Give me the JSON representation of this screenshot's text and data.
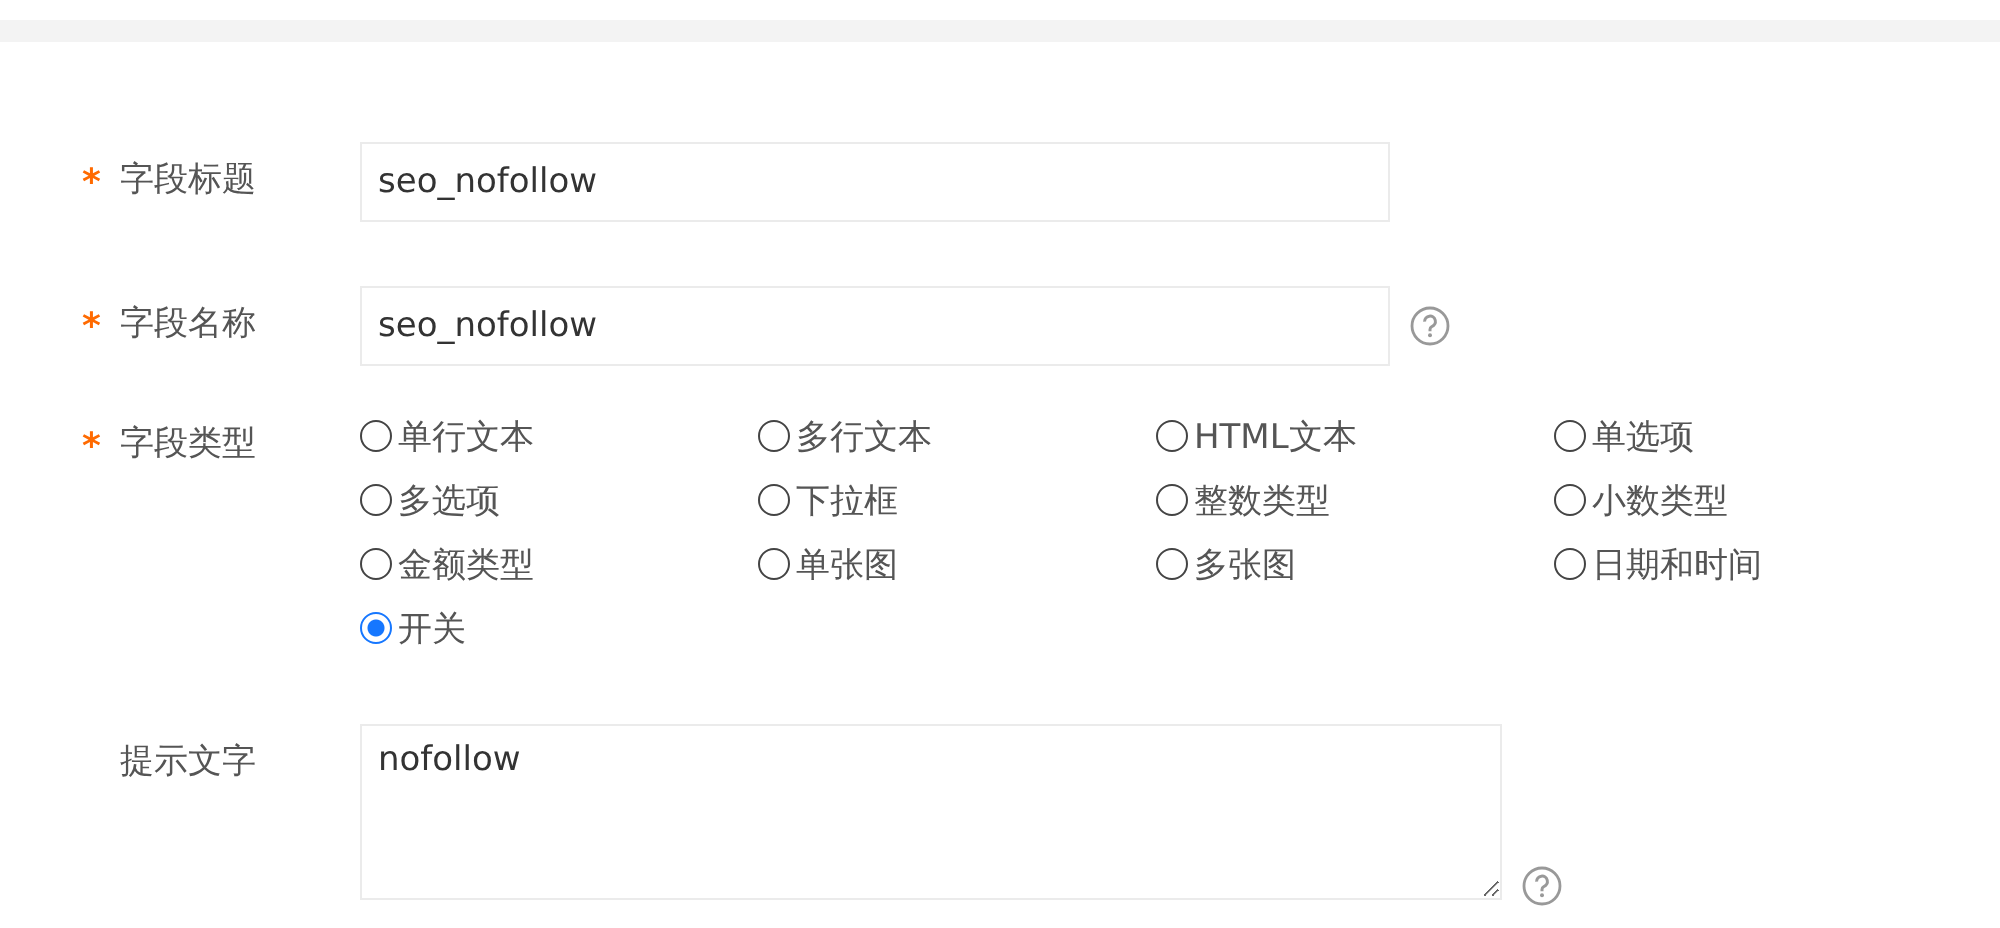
{
  "form": {
    "fields": [
      {
        "kind": "input",
        "mark": "*",
        "label": "字段标题",
        "value": "seo_nofollow",
        "help": false
      },
      {
        "kind": "input",
        "mark": "*",
        "label": "字段名称",
        "value": "seo_nofollow",
        "help": true
      },
      {
        "kind": "radio",
        "mark": "*",
        "label": "字段类型",
        "options": [
          {
            "label": "单行文本",
            "selected": false
          },
          {
            "label": "多行文本",
            "selected": false
          },
          {
            "label": "HTML文本",
            "selected": false
          },
          {
            "label": "单选项",
            "selected": false
          },
          {
            "label": "多选项",
            "selected": false
          },
          {
            "label": "下拉框",
            "selected": false
          },
          {
            "label": "整数类型",
            "selected": false
          },
          {
            "label": "小数类型",
            "selected": false
          },
          {
            "label": "金额类型",
            "selected": false
          },
          {
            "label": "单张图",
            "selected": false
          },
          {
            "label": "多张图",
            "selected": false
          },
          {
            "label": "日期和时间",
            "selected": false
          },
          {
            "label": "开关",
            "selected": true
          }
        ]
      },
      {
        "kind": "textarea",
        "label": "提示文字",
        "value": "nofollow",
        "help": true
      }
    ]
  }
}
